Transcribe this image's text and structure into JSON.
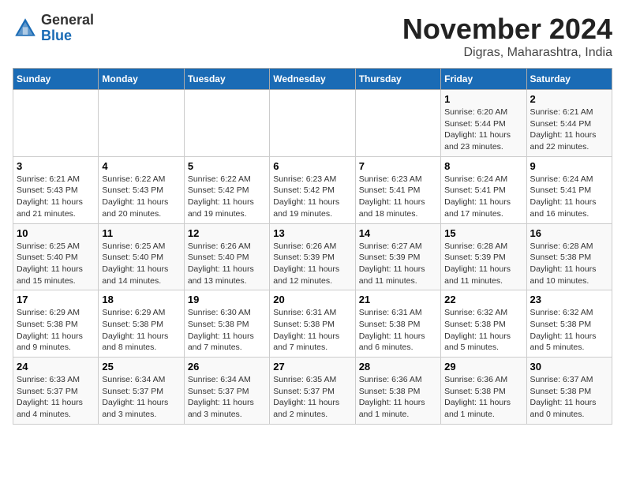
{
  "header": {
    "logo_general": "General",
    "logo_blue": "Blue",
    "month_title": "November 2024",
    "subtitle": "Digras, Maharashtra, India"
  },
  "weekdays": [
    "Sunday",
    "Monday",
    "Tuesday",
    "Wednesday",
    "Thursday",
    "Friday",
    "Saturday"
  ],
  "weeks": [
    [
      {
        "day": "",
        "info": ""
      },
      {
        "day": "",
        "info": ""
      },
      {
        "day": "",
        "info": ""
      },
      {
        "day": "",
        "info": ""
      },
      {
        "day": "",
        "info": ""
      },
      {
        "day": "1",
        "info": "Sunrise: 6:20 AM\nSunset: 5:44 PM\nDaylight: 11 hours and 23 minutes."
      },
      {
        "day": "2",
        "info": "Sunrise: 6:21 AM\nSunset: 5:44 PM\nDaylight: 11 hours and 22 minutes."
      }
    ],
    [
      {
        "day": "3",
        "info": "Sunrise: 6:21 AM\nSunset: 5:43 PM\nDaylight: 11 hours and 21 minutes."
      },
      {
        "day": "4",
        "info": "Sunrise: 6:22 AM\nSunset: 5:43 PM\nDaylight: 11 hours and 20 minutes."
      },
      {
        "day": "5",
        "info": "Sunrise: 6:22 AM\nSunset: 5:42 PM\nDaylight: 11 hours and 19 minutes."
      },
      {
        "day": "6",
        "info": "Sunrise: 6:23 AM\nSunset: 5:42 PM\nDaylight: 11 hours and 19 minutes."
      },
      {
        "day": "7",
        "info": "Sunrise: 6:23 AM\nSunset: 5:41 PM\nDaylight: 11 hours and 18 minutes."
      },
      {
        "day": "8",
        "info": "Sunrise: 6:24 AM\nSunset: 5:41 PM\nDaylight: 11 hours and 17 minutes."
      },
      {
        "day": "9",
        "info": "Sunrise: 6:24 AM\nSunset: 5:41 PM\nDaylight: 11 hours and 16 minutes."
      }
    ],
    [
      {
        "day": "10",
        "info": "Sunrise: 6:25 AM\nSunset: 5:40 PM\nDaylight: 11 hours and 15 minutes."
      },
      {
        "day": "11",
        "info": "Sunrise: 6:25 AM\nSunset: 5:40 PM\nDaylight: 11 hours and 14 minutes."
      },
      {
        "day": "12",
        "info": "Sunrise: 6:26 AM\nSunset: 5:40 PM\nDaylight: 11 hours and 13 minutes."
      },
      {
        "day": "13",
        "info": "Sunrise: 6:26 AM\nSunset: 5:39 PM\nDaylight: 11 hours and 12 minutes."
      },
      {
        "day": "14",
        "info": "Sunrise: 6:27 AM\nSunset: 5:39 PM\nDaylight: 11 hours and 11 minutes."
      },
      {
        "day": "15",
        "info": "Sunrise: 6:28 AM\nSunset: 5:39 PM\nDaylight: 11 hours and 11 minutes."
      },
      {
        "day": "16",
        "info": "Sunrise: 6:28 AM\nSunset: 5:38 PM\nDaylight: 11 hours and 10 minutes."
      }
    ],
    [
      {
        "day": "17",
        "info": "Sunrise: 6:29 AM\nSunset: 5:38 PM\nDaylight: 11 hours and 9 minutes."
      },
      {
        "day": "18",
        "info": "Sunrise: 6:29 AM\nSunset: 5:38 PM\nDaylight: 11 hours and 8 minutes."
      },
      {
        "day": "19",
        "info": "Sunrise: 6:30 AM\nSunset: 5:38 PM\nDaylight: 11 hours and 7 minutes."
      },
      {
        "day": "20",
        "info": "Sunrise: 6:31 AM\nSunset: 5:38 PM\nDaylight: 11 hours and 7 minutes."
      },
      {
        "day": "21",
        "info": "Sunrise: 6:31 AM\nSunset: 5:38 PM\nDaylight: 11 hours and 6 minutes."
      },
      {
        "day": "22",
        "info": "Sunrise: 6:32 AM\nSunset: 5:38 PM\nDaylight: 11 hours and 5 minutes."
      },
      {
        "day": "23",
        "info": "Sunrise: 6:32 AM\nSunset: 5:38 PM\nDaylight: 11 hours and 5 minutes."
      }
    ],
    [
      {
        "day": "24",
        "info": "Sunrise: 6:33 AM\nSunset: 5:37 PM\nDaylight: 11 hours and 4 minutes."
      },
      {
        "day": "25",
        "info": "Sunrise: 6:34 AM\nSunset: 5:37 PM\nDaylight: 11 hours and 3 minutes."
      },
      {
        "day": "26",
        "info": "Sunrise: 6:34 AM\nSunset: 5:37 PM\nDaylight: 11 hours and 3 minutes."
      },
      {
        "day": "27",
        "info": "Sunrise: 6:35 AM\nSunset: 5:37 PM\nDaylight: 11 hours and 2 minutes."
      },
      {
        "day": "28",
        "info": "Sunrise: 6:36 AM\nSunset: 5:38 PM\nDaylight: 11 hours and 1 minute."
      },
      {
        "day": "29",
        "info": "Sunrise: 6:36 AM\nSunset: 5:38 PM\nDaylight: 11 hours and 1 minute."
      },
      {
        "day": "30",
        "info": "Sunrise: 6:37 AM\nSunset: 5:38 PM\nDaylight: 11 hours and 0 minutes."
      }
    ]
  ]
}
